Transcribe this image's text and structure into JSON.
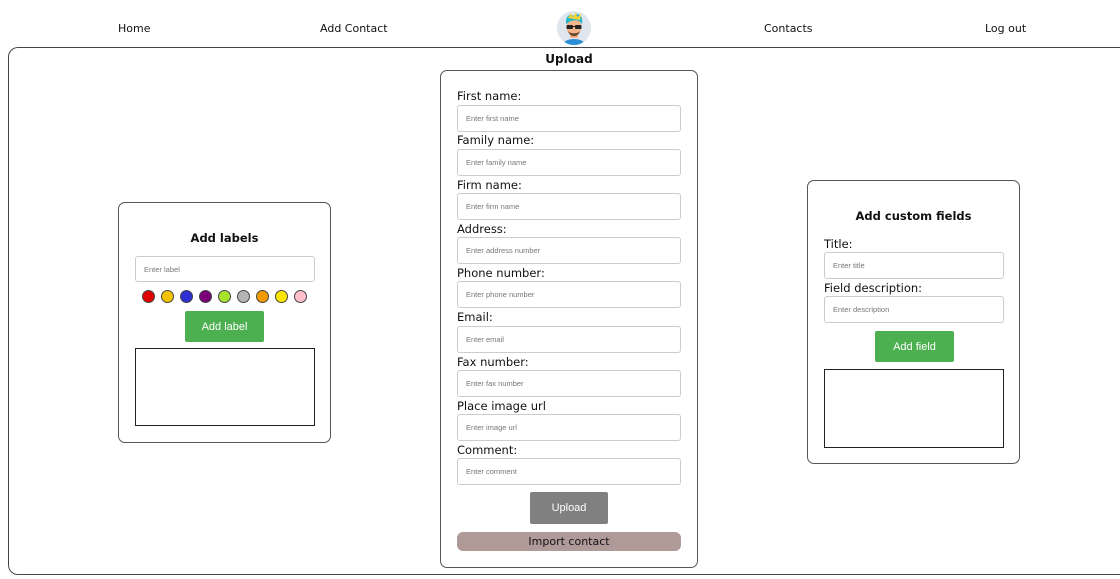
{
  "nav": {
    "home": "Home",
    "add_contact": "Add Contact",
    "contacts": "Contacts",
    "logout": "Log out"
  },
  "labels_panel": {
    "title": "Add labels",
    "input_placeholder": "Enter label",
    "colors": [
      "#e00000",
      "#f2c200",
      "#2f2fd6",
      "#7a007a",
      "#a6e22e",
      "#b5b5b5",
      "#f29b00",
      "#ffe600",
      "#ffc0cb"
    ],
    "button": "Add label"
  },
  "form": {
    "title": "Upload",
    "fields": [
      {
        "label": "First name:",
        "placeholder": "Enter first name"
      },
      {
        "label": "Family name:",
        "placeholder": "Enter family name"
      },
      {
        "label": "Firm name:",
        "placeholder": "Enter firm name"
      },
      {
        "label": "Address:",
        "placeholder": "Enter address number"
      },
      {
        "label": "Phone number:",
        "placeholder": "Enter phone number"
      },
      {
        "label": "Email:",
        "placeholder": "Enter email"
      },
      {
        "label": "Fax number:",
        "placeholder": "Enter fax number"
      },
      {
        "label": "Place image url",
        "placeholder": "Enter image url"
      },
      {
        "label": "Comment:",
        "placeholder": "Enter comment"
      }
    ],
    "upload_button": "Upload",
    "import_button": "Import contact"
  },
  "custom_panel": {
    "title": "Add custom fields",
    "title_label": "Title:",
    "title_placeholder": "Enter title",
    "description_label": "Field description:",
    "description_placeholder": "Enter description",
    "button": "Add field"
  }
}
